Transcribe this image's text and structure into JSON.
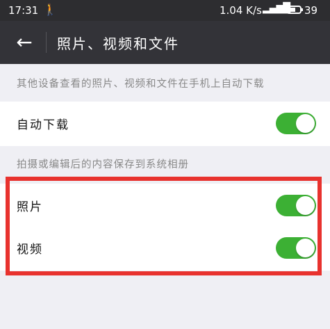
{
  "status_bar": {
    "time": "17:31",
    "network_speed": "1.04 K/s",
    "signal": "4G",
    "battery_level": "39"
  },
  "nav": {
    "back_icon": "←",
    "title": "照片、视频和文件"
  },
  "sections": {
    "auto_download_header": "其他设备查看的照片、视频和文件在手机上自动下载",
    "auto_download_label": "自动下载",
    "save_header": "拍摄或编辑后的内容保存到系统相册",
    "photo_label": "照片",
    "video_label": "视频"
  },
  "toggles": {
    "auto_download": true,
    "photo": true,
    "video": true
  },
  "colors": {
    "toggle_on": "#3cb034",
    "nav_bg": "#333338",
    "highlight": "#e8322e"
  }
}
